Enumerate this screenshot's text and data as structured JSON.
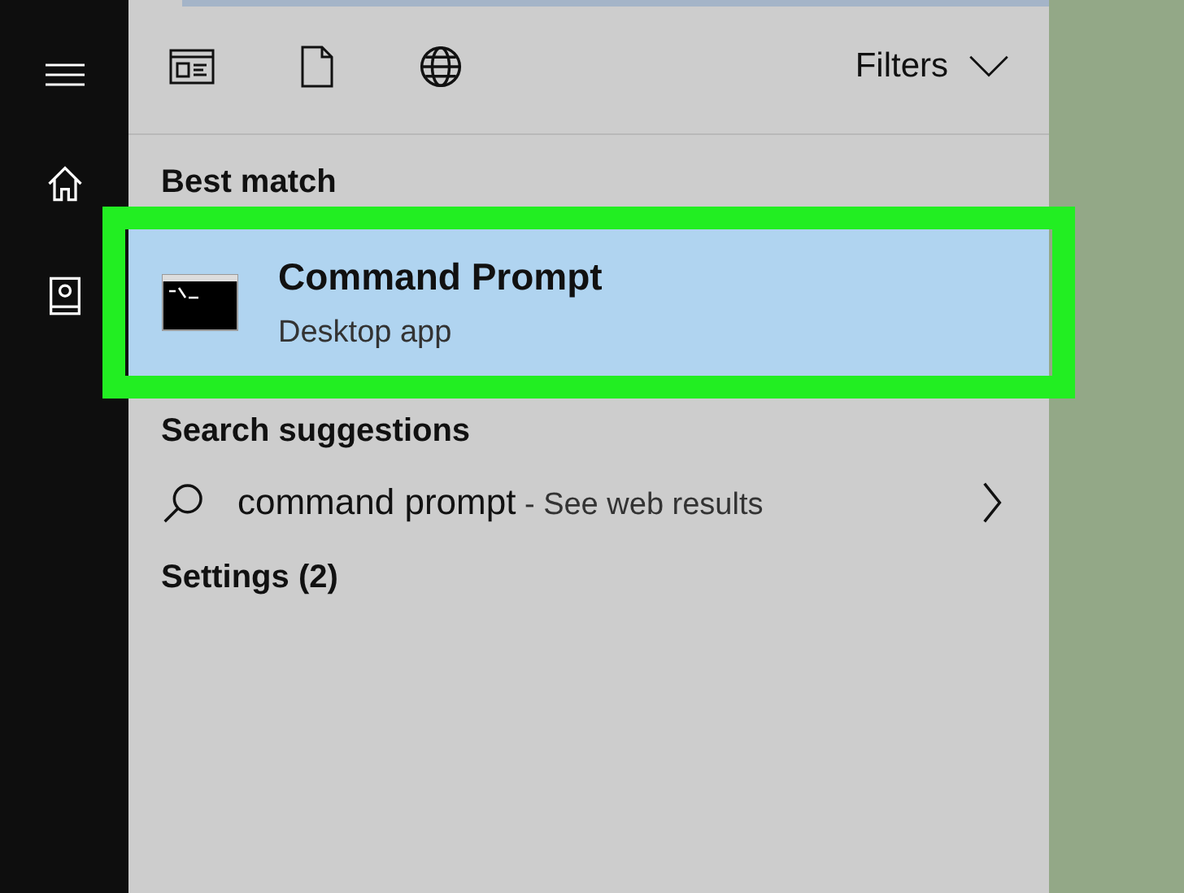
{
  "toolbar": {
    "filters_label": "Filters"
  },
  "sections": [
    {
      "kind": "results",
      "heading": "Best match",
      "items": [
        {
          "title": "Command Prompt",
          "subtitle": "Desktop app",
          "selected": true,
          "highlighted": true
        }
      ]
    },
    {
      "kind": "suggestions",
      "heading": "Search suggestions",
      "items": [
        {
          "query": "command prompt",
          "hint": " - See web results"
        }
      ]
    },
    {
      "kind": "group",
      "heading": "Settings (2)"
    }
  ]
}
